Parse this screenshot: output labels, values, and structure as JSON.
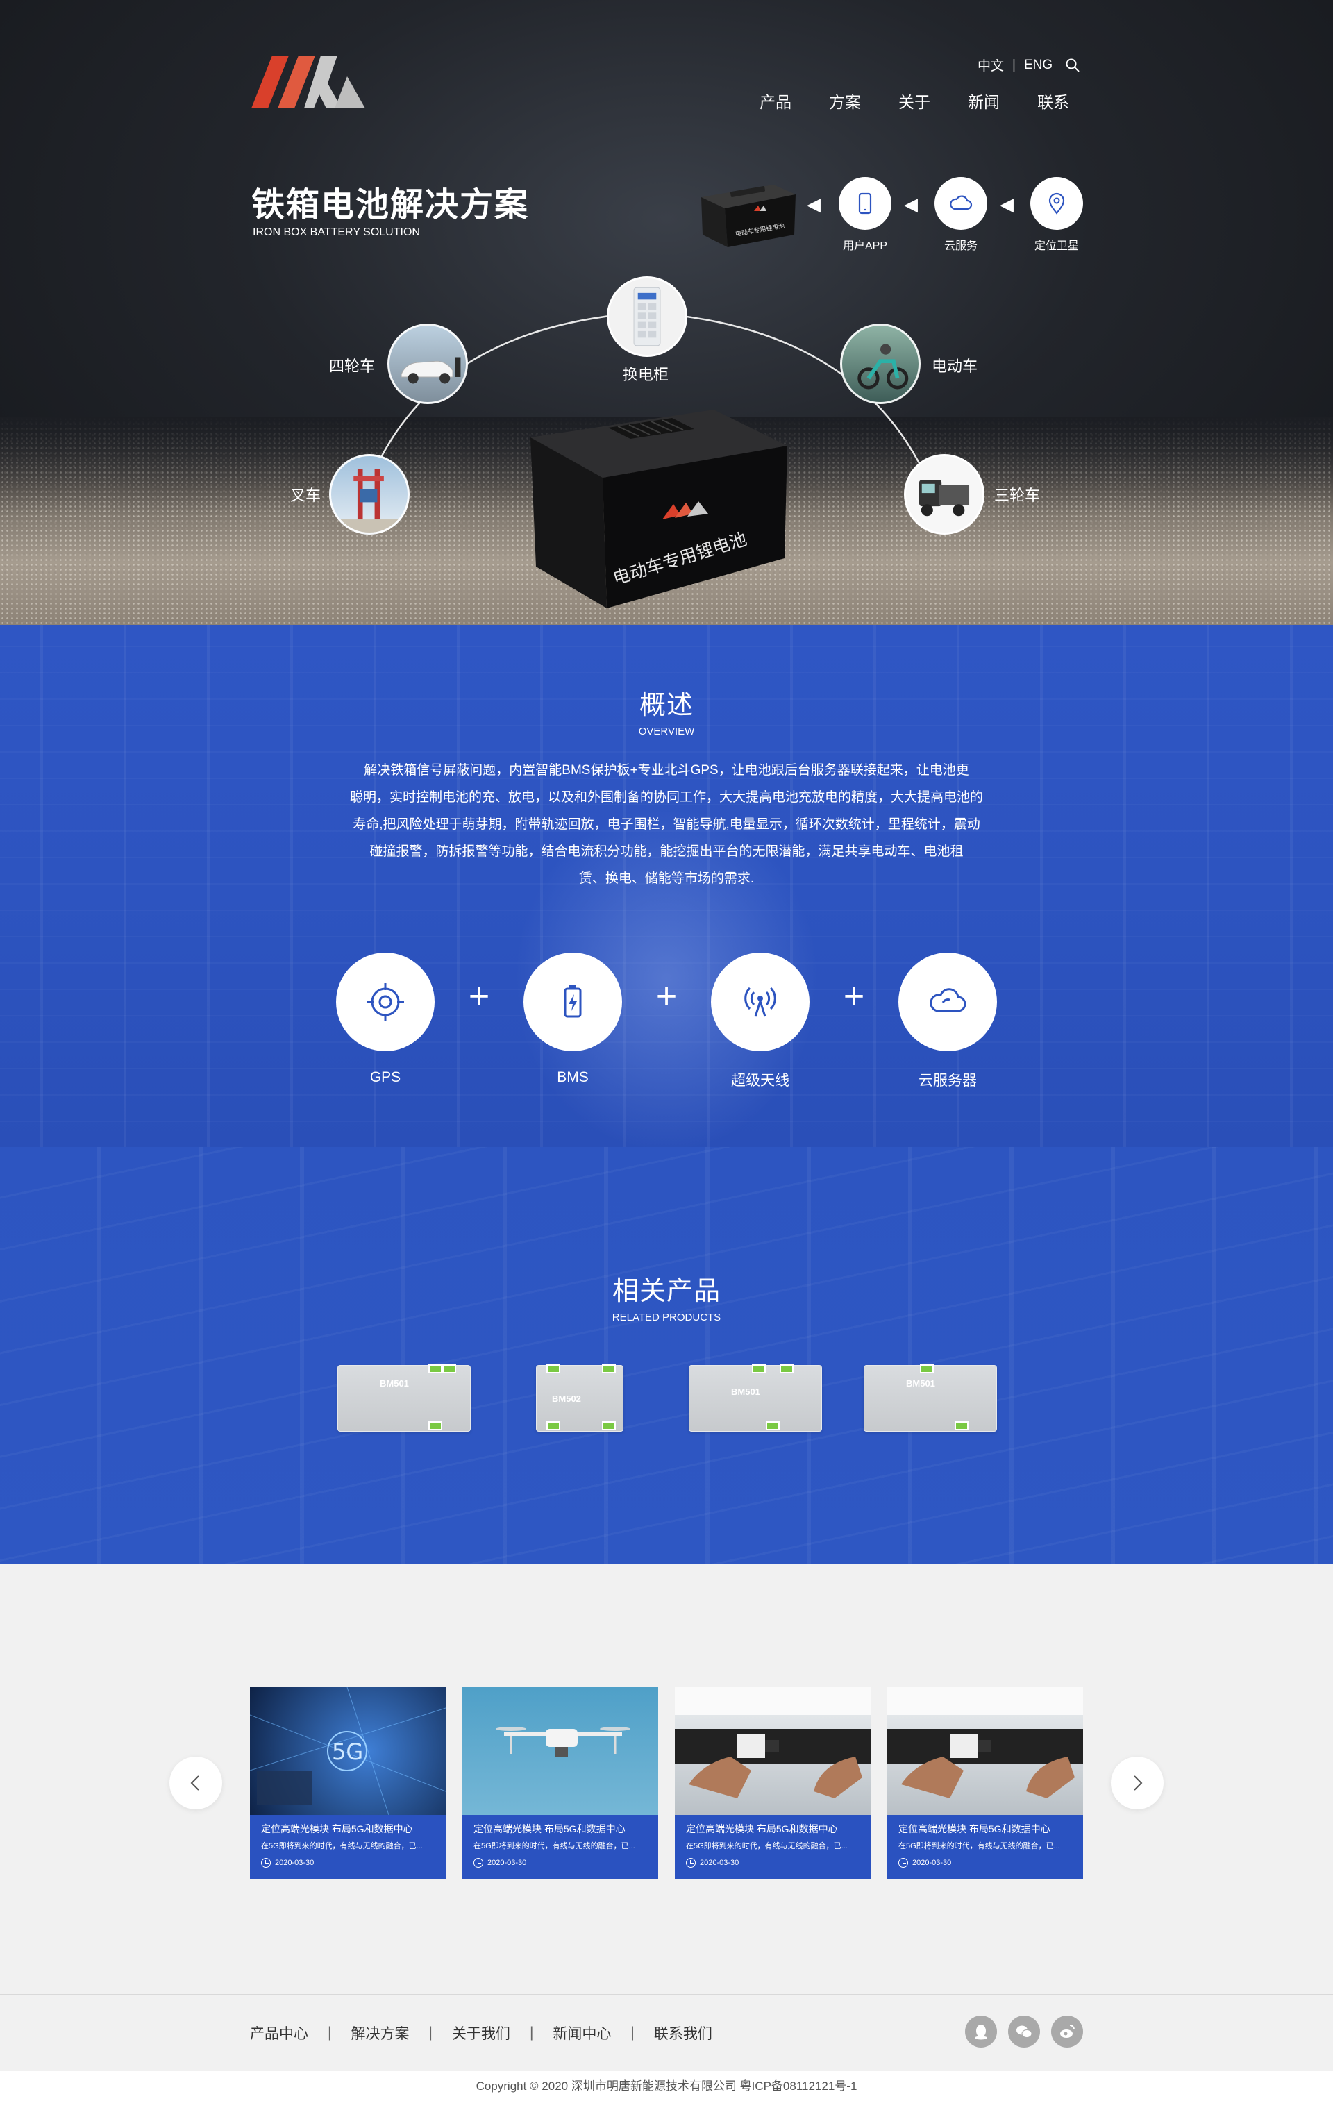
{
  "header": {
    "lang_cn": "中文",
    "lang_sep": "|",
    "lang_en": "ENG",
    "nav": [
      "产品",
      "方案",
      "关于",
      "新闻",
      "联系"
    ]
  },
  "hero": {
    "title": "铁箱电池解决方案",
    "subtitle": "IRON BOX BATTERY SOLUTION",
    "chain": [
      {
        "label": "用户APP",
        "icon": "phone-icon"
      },
      {
        "label": "云服务",
        "icon": "cloud-icon"
      },
      {
        "label": "定位卫星",
        "icon": "location-pin-icon"
      }
    ],
    "nodes": {
      "cabinet": "换电柜",
      "four_wheel": "四轮车",
      "e_bike": "电动车",
      "forklift": "叉车",
      "tricycle": "三轮车"
    },
    "box_text": "电动车专用锂电池",
    "mini_box_text": "电动车专用锂电池"
  },
  "overview": {
    "title": "概述",
    "subtitle": "OVERVIEW",
    "lines": [
      "解决铁箱信号屏蔽问题，内置智能BMS保护板+专业北斗GPS，让电池跟后台服务器联接起来，让电池更",
      "聪明，实时控制电池的充、放电，以及和外围制备的协同工作，大大提高电池充放电的精度，大大提高电池的",
      "寿命,把风险处理于萌芽期，附带轨迹回放，电子围栏，智能导航,电量显示，循环次数统计，里程统计，震动",
      "碰撞报警，防拆报警等功能，结合电流积分功能，能挖掘出平台的无限潜能，满足共享电动车、电池租",
      "赁、换电、储能等市场的需求."
    ],
    "features": [
      {
        "label": "GPS",
        "icon": "target-icon"
      },
      {
        "label": "BMS",
        "icon": "battery-icon"
      },
      {
        "label": "超级天线",
        "icon": "antenna-icon"
      },
      {
        "label": "云服务器",
        "icon": "cloud-icon"
      }
    ],
    "plus": "+"
  },
  "related": {
    "title": "相关产品",
    "subtitle": "RELATED PRODUCTS",
    "boards": [
      "BM501",
      "BM502",
      "BM501",
      "BM501"
    ]
  },
  "news": {
    "cards": [
      {
        "title": "定位高端光模块 布局5G和数据中心",
        "desc": "在5G即将到来的时代，有线与无线的融合，已...",
        "date": "2020-03-30"
      },
      {
        "title": "定位高端光模块 布局5G和数据中心",
        "desc": "在5G即将到来的时代，有线与无线的融合，已...",
        "date": "2020-03-30"
      },
      {
        "title": "定位高端光模块 布局5G和数据中心",
        "desc": "在5G即将到来的时代，有线与无线的融合，已...",
        "date": "2020-03-30"
      },
      {
        "title": "定位高端光模块 布局5G和数据中心",
        "desc": "在5G即将到来的时代，有线与无线的融合，已...",
        "date": "2020-03-30"
      }
    ],
    "pic_text": "5G"
  },
  "footer": {
    "links": [
      "产品中心",
      "解决方案",
      "关于我们",
      "新闻中心",
      "联系我们"
    ],
    "sep": "|",
    "copyright": "Copyright © 2020  深圳市明唐新能源技术有限公司  粤ICP备08112121号-1"
  },
  "colors": {
    "brand_blue": "#2d54c0",
    "logo_red": "#d9402b",
    "logo_gray": "#c8c8c8"
  }
}
